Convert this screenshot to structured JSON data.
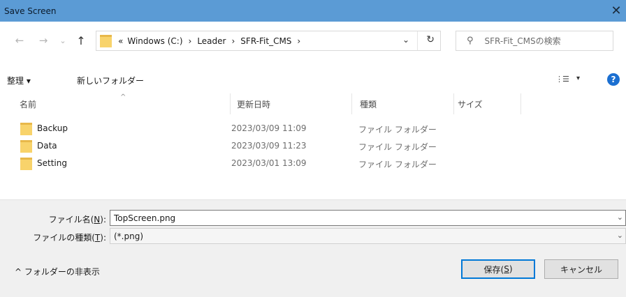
{
  "window": {
    "title": "Save Screen",
    "close_glyph": "✕"
  },
  "nav": {
    "back": "←",
    "forward": "→",
    "recent": "⌄",
    "up": "↑"
  },
  "address": {
    "prefix": "«",
    "crumbs": [
      "Windows (C:)",
      "Leader",
      "SFR-Fit_CMS"
    ],
    "separator": "›",
    "dropdown": "⌄",
    "refresh": "↻"
  },
  "search": {
    "placeholder": "SFR-Fit_CMSの検索",
    "icon": "search-icon"
  },
  "toolbar": {
    "organize": "整理 ▾",
    "new_folder": "新しいフォルダー",
    "view_icon": "⋮☰",
    "view_dd": "▾",
    "help": "?"
  },
  "columns": {
    "name": "名前",
    "modified": "更新日時",
    "type": "種類",
    "size": "サイズ",
    "sort": "^"
  },
  "files": [
    {
      "name": "Backup",
      "modified": "2023/03/09 11:09",
      "type": "ファイル フォルダー"
    },
    {
      "name": "Data",
      "modified": "2023/03/09 11:23",
      "type": "ファイル フォルダー"
    },
    {
      "name": "Setting",
      "modified": "2023/03/01 13:09",
      "type": "ファイル フォルダー"
    }
  ],
  "form": {
    "filename_label_pre": "ファイル名(",
    "filename_label_key": "N",
    "filename_label_post": "):",
    "filename_value": "TopScreen.png",
    "filetype_label_pre": "ファイルの種類(",
    "filetype_label_key": "T",
    "filetype_label_post": "):",
    "filetype_value": "(*.png)",
    "dropdown": "⌄"
  },
  "footer": {
    "toggle": "^ フォルダーの非表示",
    "save_pre": "保存(",
    "save_key": "S",
    "save_post": ")",
    "cancel": "キャンセル"
  },
  "colors": {
    "titlebar": "#5b9bd5",
    "folder": "#f8d36b",
    "accent": "#0078d7"
  }
}
